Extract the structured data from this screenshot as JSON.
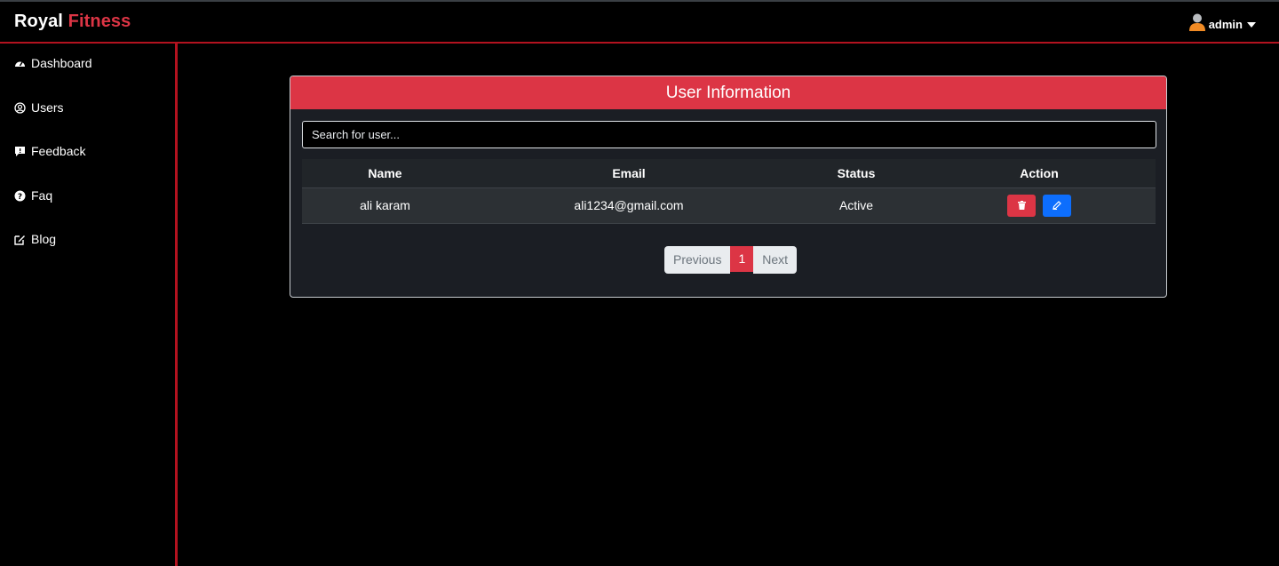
{
  "brand": {
    "part1": "Royal",
    "part2": "Fitness"
  },
  "user_menu": {
    "name": "admin",
    "icon": "user-icon",
    "caret_icon": "caret-down-icon"
  },
  "sidebar": {
    "items": [
      {
        "label": "Dashboard",
        "icon": "tachometer-icon"
      },
      {
        "label": "Users",
        "icon": "user-circle-icon"
      },
      {
        "label": "Feedback",
        "icon": "comment-icon"
      },
      {
        "label": "Faq",
        "icon": "question-circle-icon"
      },
      {
        "label": "Blog",
        "icon": "edit-icon"
      }
    ]
  },
  "card": {
    "title": "User Information",
    "search_placeholder": "Search for user...",
    "columns": [
      "Name",
      "Email",
      "Status",
      "Action"
    ],
    "rows": [
      {
        "name": "ali karam",
        "email": "ali1234@gmail.com",
        "status": "Active"
      }
    ],
    "actions": {
      "delete_icon": "trash-icon",
      "edit_icon": "pencil-icon"
    }
  },
  "pagination": {
    "previous": "Previous",
    "page": "1",
    "next": "Next"
  },
  "colors": {
    "accent": "#dc3545",
    "edit": "#0d6efd",
    "card_bg": "#1b1e24"
  }
}
